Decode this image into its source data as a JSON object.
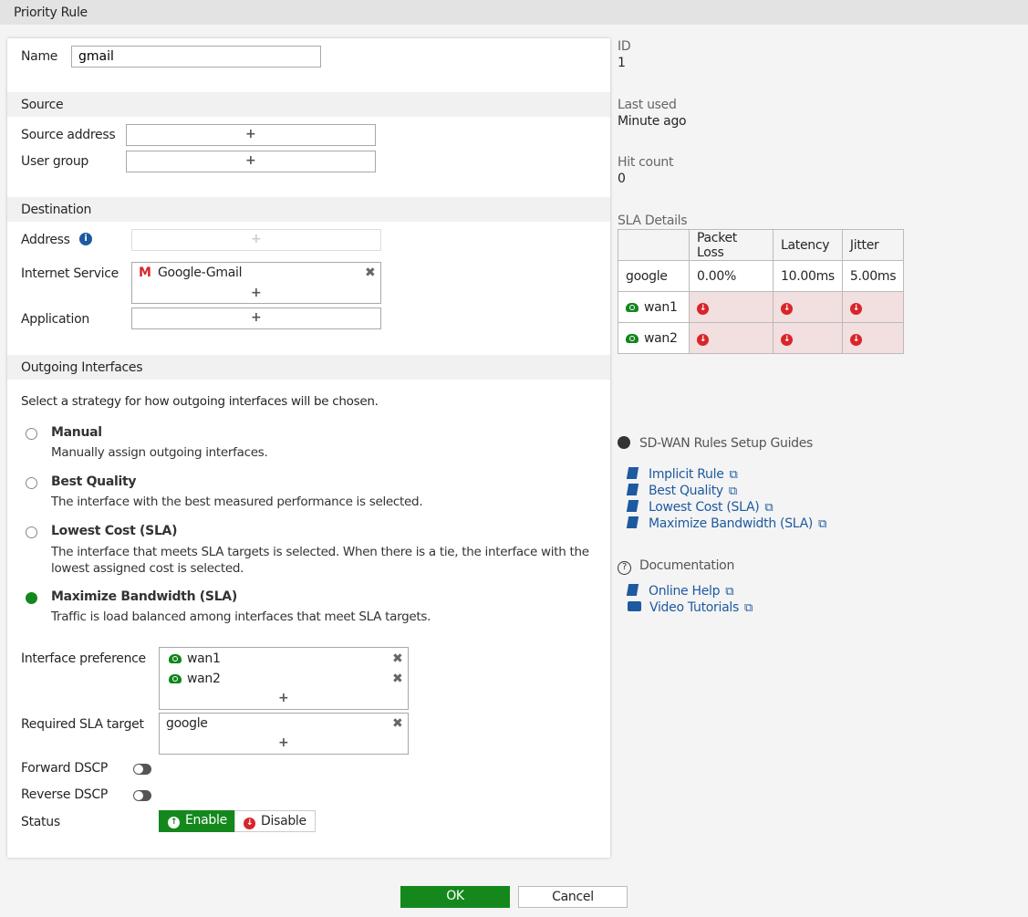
{
  "title": "Priority Rule",
  "name": {
    "label": "Name",
    "value": "gmail"
  },
  "source": {
    "header": "Source",
    "address_label": "Source address",
    "user_group_label": "User group",
    "add": "+"
  },
  "destination": {
    "header": "Destination",
    "address_label": "Address",
    "internet_service_label": "Internet Service",
    "internet_service_value": "Google-Gmail",
    "application_label": "Application",
    "add": "+"
  },
  "outgoing": {
    "header": "Outgoing Interfaces",
    "intro": "Select a strategy for how outgoing interfaces will be chosen.",
    "strategies": [
      {
        "title": "Manual",
        "desc": "Manually assign outgoing interfaces.",
        "selected": false
      },
      {
        "title": "Best Quality",
        "desc": "The interface with the best measured performance is selected.",
        "selected": false
      },
      {
        "title": "Lowest Cost (SLA)",
        "desc": "The interface that meets SLA targets is selected. When there is a tie, the interface with the lowest assigned cost is selected.",
        "selected": false
      },
      {
        "title": "Maximize Bandwidth (SLA)",
        "desc": "Traffic is load balanced among interfaces that meet SLA targets.",
        "selected": true
      }
    ],
    "interface_pref_label": "Interface preference",
    "interfaces": [
      "wan1",
      "wan2"
    ],
    "sla_label": "Required SLA target",
    "sla_value": "google",
    "forward_dscp_label": "Forward DSCP",
    "forward_dscp": false,
    "reverse_dscp_label": "Reverse DSCP",
    "reverse_dscp": false,
    "status_label": "Status",
    "enable": "Enable",
    "disable": "Disable",
    "status": "Enable"
  },
  "info": {
    "id_label": "ID",
    "id": "1",
    "last_used_label": "Last used",
    "last_used": "Minute ago",
    "hit_label": "Hit count",
    "hit": "0"
  },
  "sla": {
    "title": "SLA Details",
    "headers": [
      "Packet Loss",
      "Latency",
      "Jitter"
    ],
    "target": "google",
    "values": [
      "0.00%",
      "10.00ms",
      "5.00ms"
    ],
    "rows": [
      "wan1",
      "wan2"
    ]
  },
  "guides": {
    "title": "SD-WAN Rules Setup Guides",
    "links": [
      "Implicit Rule",
      "Best Quality",
      "Lowest Cost (SLA)",
      "Maximize Bandwidth (SLA)"
    ]
  },
  "docs": {
    "title": "Documentation",
    "links": [
      "Online Help",
      "Video Tutorials"
    ]
  },
  "footer": {
    "ok": "OK",
    "cancel": "Cancel"
  },
  "colors": {
    "green": "#14881c",
    "red": "#d9252a",
    "link": "#1d5aa0"
  }
}
